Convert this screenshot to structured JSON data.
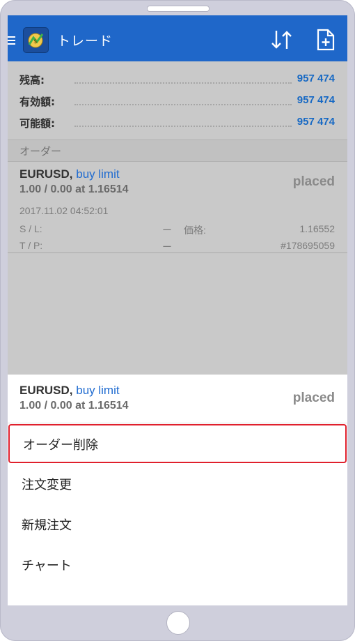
{
  "app": {
    "title": "トレード"
  },
  "balances": [
    {
      "label": "残高:",
      "value": "957 474"
    },
    {
      "label": "有効額:",
      "value": "957 474"
    },
    {
      "label": "可能額:",
      "value": "957 474"
    }
  ],
  "orders_section": {
    "title": "オーダー"
  },
  "order": {
    "symbol": "EURUSD,",
    "type": "buy limit",
    "volume_line": "1.00 / 0.00 at 1.16514",
    "status": "placed",
    "time": "2017.11.02 04:52:01",
    "sl_label": "S / L:",
    "sl_value": "ー",
    "tp_label": "T / P:",
    "tp_value": "ー",
    "price_label": "価格:",
    "price_value": "1.16552",
    "ticket": "#178695059"
  },
  "context_menu": {
    "header": {
      "symbol": "EURUSD,",
      "type": "buy limit",
      "volume_line": "1.00 / 0.00 at 1.16514",
      "status": "placed"
    },
    "items": [
      {
        "label": "オーダー削除"
      },
      {
        "label": "注文変更"
      },
      {
        "label": "新規注文"
      },
      {
        "label": "チャート"
      }
    ]
  },
  "colors": {
    "accent": "#1f67c9",
    "value_blue": "#1769c4",
    "highlight": "#e0202c"
  },
  "icons": [
    "menu-icon",
    "app-logo-icon",
    "sort-icon",
    "new-document-icon"
  ]
}
